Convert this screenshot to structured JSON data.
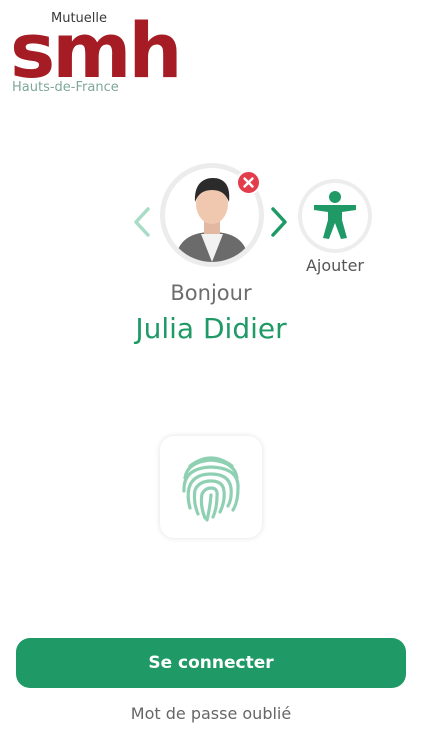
{
  "brand": {
    "top": "Mutuelle",
    "main": "smh",
    "sub": "Hauts-de-France"
  },
  "profile": {
    "greeting": "Bonjour",
    "name": "Julia Didier"
  },
  "add_profile": {
    "label": "Ajouter"
  },
  "actions": {
    "connect_label": "Se connecter",
    "forgot_password": "Mot de passe oublié"
  },
  "colors": {
    "brand_red": "#a51c24",
    "accent_green": "#1f9a66",
    "remove_red": "#e33d4c"
  },
  "icons": {
    "prev": "chevron-left-icon",
    "next": "chevron-right-icon",
    "remove": "close-icon",
    "add": "accessibility-person-icon",
    "biometric": "fingerprint-icon"
  }
}
